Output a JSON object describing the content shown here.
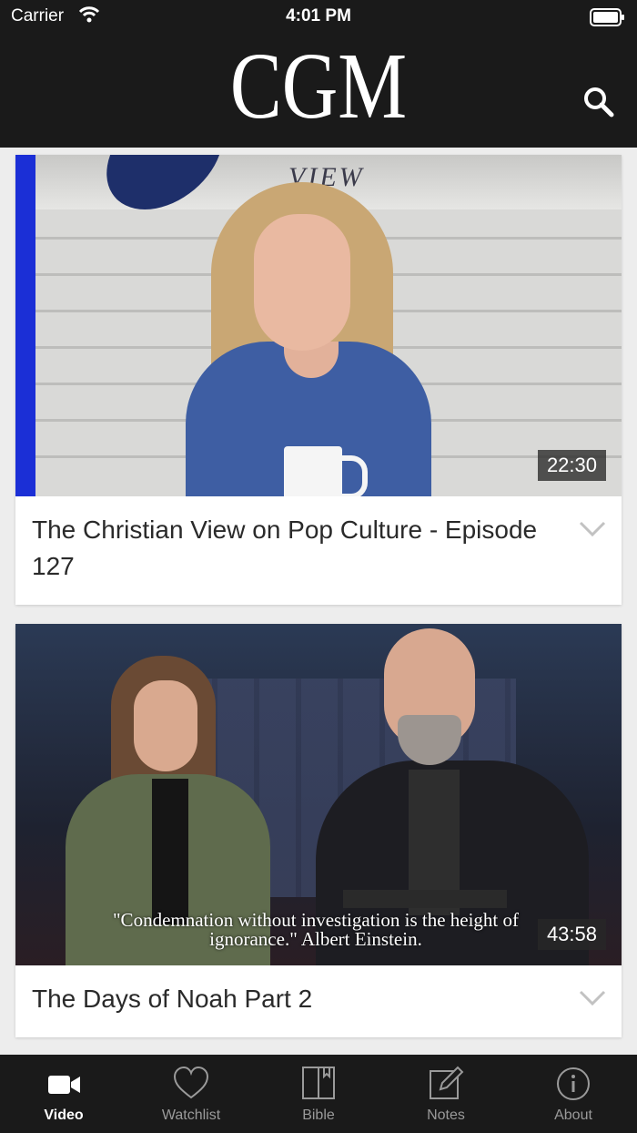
{
  "status_bar": {
    "carrier": "Carrier",
    "time": "4:01 PM"
  },
  "header": {
    "logo": "CGM",
    "search_icon": "search-icon"
  },
  "videos": [
    {
      "title": "The Christian View on Pop Culture - Episode 127",
      "duration": "22:30",
      "thumbnail_text": "VIEW"
    },
    {
      "title": "The Days of Noah Part 2",
      "duration": "43:58",
      "thumbnail_caption_line1": "\"Condemnation without investigation is the height of",
      "thumbnail_caption_line2": "ignorance.\" Albert  Einstein."
    }
  ],
  "tabs": [
    {
      "label": "Video",
      "icon": "video-camera-icon",
      "active": true
    },
    {
      "label": "Watchlist",
      "icon": "heart-icon",
      "active": false
    },
    {
      "label": "Bible",
      "icon": "book-icon",
      "active": false
    },
    {
      "label": "Notes",
      "icon": "note-pencil-icon",
      "active": false
    },
    {
      "label": "About",
      "icon": "info-icon",
      "active": false
    }
  ],
  "colors": {
    "bar_background": "#1a1a1a",
    "tab_active": "#ffffff",
    "tab_inactive": "#9a9a9a",
    "page_background": "#ededed"
  }
}
